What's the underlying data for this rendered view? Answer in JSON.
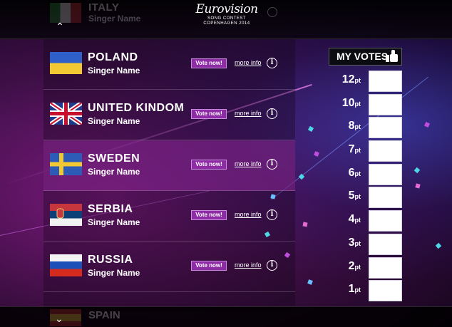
{
  "header": {
    "ghost_country": "ITALY",
    "ghost_singer": "Singer Name",
    "logo_line1": "Eurovision",
    "logo_line2": "SONG CONTEST",
    "logo_line3": "COPENHAGEN 2014"
  },
  "rows": [
    {
      "country": "POLAND",
      "singer": "Singer Name",
      "vote": "Vote now!",
      "more": "more info"
    },
    {
      "country": "UNITED KINDOM",
      "singer": "Singer Name",
      "vote": "Vote now!",
      "more": "more info"
    },
    {
      "country": "SWEDEN",
      "singer": "Singer Name",
      "vote": "Vote now!",
      "more": "more info"
    },
    {
      "country": "SERBIA",
      "singer": "Singer Name",
      "vote": "Vote now!",
      "more": "more info"
    },
    {
      "country": "RUSSIA",
      "singer": "Singer Name",
      "vote": "Vote now!",
      "more": "more info"
    }
  ],
  "selected_row": 2,
  "footer": {
    "ghost_country": "SPAIN"
  },
  "votes": {
    "title": "MY VOTES",
    "points": [
      "12",
      "10",
      "8",
      "7",
      "6",
      "5",
      "4",
      "3",
      "2",
      "1"
    ],
    "unit": "pt"
  },
  "icons": {
    "info": "i",
    "scroll_up": "^",
    "scroll_down": "v"
  },
  "colors": {
    "accent": "#8e2ca6",
    "selected_row": "#8c2896"
  }
}
